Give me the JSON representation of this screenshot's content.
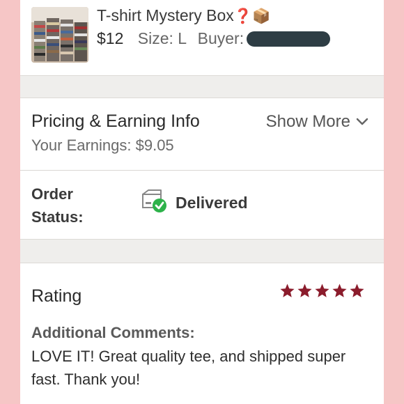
{
  "item": {
    "title": "T-shirt Mystery Box",
    "title_emoji": "❓📦",
    "price": "$12",
    "size_label": "Size: L",
    "buyer_label": "Buyer:",
    "thumbnail": "stacked-tshirts-image"
  },
  "pricing": {
    "title": "Pricing & Earning Info",
    "show_more": "Show More",
    "earnings": "Your Earnings: $9.05"
  },
  "status": {
    "label_line1": "Order",
    "label_line2": "Status:",
    "value": "Delivered",
    "icon": "box-check-icon"
  },
  "rating": {
    "title": "Rating",
    "stars": 5,
    "star_color": "#8b1c2c",
    "comments_label": "Additional Comments:",
    "comment": "LOVE IT! Great quality tee, and shipped super fast. Thank you!"
  },
  "colors": {
    "side_background": "#f6c6c6",
    "check_green": "#2db24a",
    "redaction": "#2e3d44"
  }
}
